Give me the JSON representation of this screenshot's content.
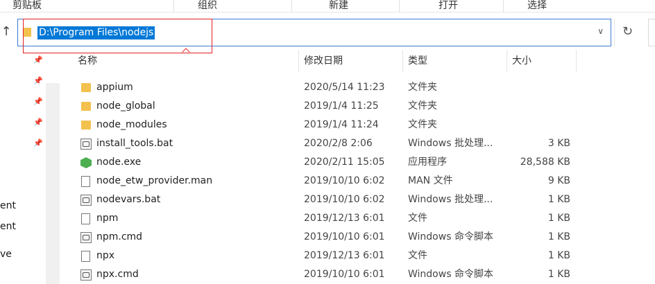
{
  "ribbon": {
    "groups": [
      "剪贴板",
      "组织",
      "新建",
      "打开",
      "选择"
    ]
  },
  "address": {
    "path": "D:\\Program Files\\nodejs",
    "up_icon": "↑",
    "dropdown_icon": "∨",
    "refresh_icon": "↻"
  },
  "nav": {
    "pin_icon": "📌",
    "items": [
      "ent",
      "ent",
      "ve"
    ]
  },
  "columns": {
    "name": "名称",
    "date": "修改日期",
    "type": "类型",
    "size": "大小"
  },
  "files": [
    {
      "name": "appium",
      "date": "2020/5/14 11:23",
      "type": "文件夹",
      "size": "",
      "icon": "folder-icon"
    },
    {
      "name": "node_global",
      "date": "2019/1/4 11:25",
      "type": "文件夹",
      "size": "",
      "icon": "folder-icon"
    },
    {
      "name": "node_modules",
      "date": "2019/1/4 11:24",
      "type": "文件夹",
      "size": "",
      "icon": "folder-icon"
    },
    {
      "name": "install_tools.bat",
      "date": "2020/2/8 2:06",
      "type": "Windows 批处理...",
      "size": "3 KB",
      "icon": "batch-file-icon"
    },
    {
      "name": "node.exe",
      "date": "2020/2/11 15:05",
      "type": "应用程序",
      "size": "28,588 KB",
      "icon": "node-exe-icon"
    },
    {
      "name": "node_etw_provider.man",
      "date": "2019/10/10 6:02",
      "type": "MAN 文件",
      "size": "9 KB",
      "icon": "file-icon"
    },
    {
      "name": "nodevars.bat",
      "date": "2019/10/10 6:02",
      "type": "Windows 批处理...",
      "size": "1 KB",
      "icon": "batch-file-icon"
    },
    {
      "name": "npm",
      "date": "2019/12/13 6:01",
      "type": "文件",
      "size": "1 KB",
      "icon": "file-icon"
    },
    {
      "name": "npm.cmd",
      "date": "2019/10/10 6:01",
      "type": "Windows 命令脚本",
      "size": "1 KB",
      "icon": "batch-file-icon"
    },
    {
      "name": "npx",
      "date": "2019/12/13 6:01",
      "type": "文件",
      "size": "1 KB",
      "icon": "file-icon"
    },
    {
      "name": "npx.cmd",
      "date": "2019/10/10 6:01",
      "type": "Windows 命令脚本",
      "size": "1 KB",
      "icon": "batch-file-icon"
    }
  ],
  "colors": {
    "selection": "#0078d7",
    "annotation": "#e02020",
    "folder": "#f2c14e"
  }
}
